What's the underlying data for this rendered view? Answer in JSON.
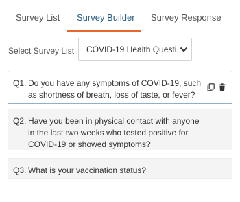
{
  "tabs": [
    {
      "label": "Survey List",
      "active": false
    },
    {
      "label": "Survey Builder",
      "active": true
    },
    {
      "label": "Survey Response",
      "active": false
    }
  ],
  "colors": {
    "accent_underline": "#e8672e",
    "active_tab_text": "#2b5f86",
    "active_card_border": "#8fb0c8"
  },
  "selector": {
    "label": "Select Survey List",
    "value": "COVID-19 Health Questi...",
    "icon": "chevron-down-icon"
  },
  "questions": [
    {
      "number": "Q1.",
      "text": "Do you have any symptoms of COVID-19, such as shortness of breath, loss of taste, or fever?",
      "active": true,
      "actions": [
        "copy-icon",
        "trash-icon"
      ]
    },
    {
      "number": "Q2.",
      "text": "Have you been in physical contact with anyone in the last two weeks who tested positive for COVID-19 or showed symptoms?",
      "active": false
    },
    {
      "number": "Q3.",
      "text": "What is your vaccination status?",
      "active": false
    }
  ]
}
